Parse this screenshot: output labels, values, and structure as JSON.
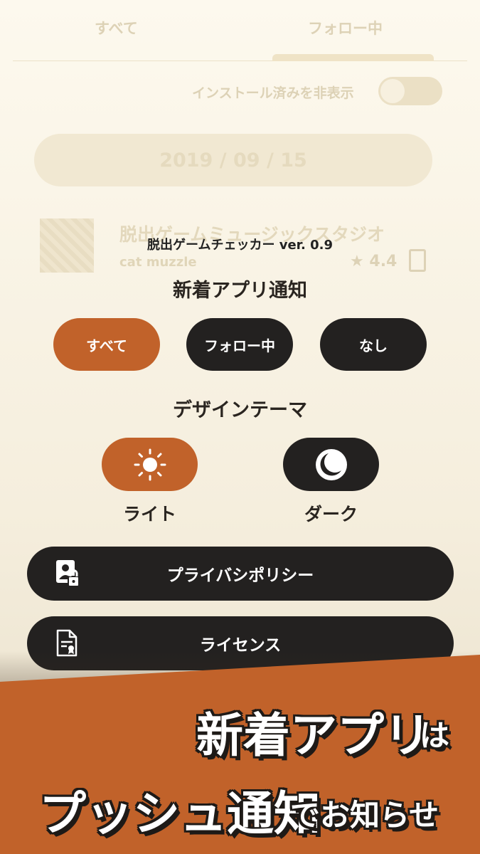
{
  "background_app": {
    "tabs": [
      "すべて",
      "フォロー中"
    ],
    "hide_installed_label": "インストール済みを非表示",
    "date": "2019 / 09 / 15",
    "app_title": "脱出ゲームミュージックスタジオ",
    "app_developer": "cat muzzle",
    "rating": "★ 4.4"
  },
  "settings": {
    "version": "脱出ゲームチェッカー ver. 0.9",
    "notify_title": "新着アプリ通知",
    "notify_options": [
      "すべて",
      "フォロー中",
      "なし"
    ],
    "notify_selected": "すべて",
    "theme_title": "デザインテーマ",
    "theme_light_label": "ライト",
    "theme_dark_label": "ダーク",
    "theme_selected": "ライト",
    "privacy_label": "プライバシポリシー",
    "license_label": "ライセンス"
  },
  "promo": {
    "line1_big": "新着アプリ",
    "line1_small": "は",
    "line2_big": "プッシュ通知",
    "line2_small": "でお知らせ"
  },
  "colors": {
    "accent": "#c1622a",
    "button_dark": "#232120",
    "background": "#f5eedd"
  }
}
